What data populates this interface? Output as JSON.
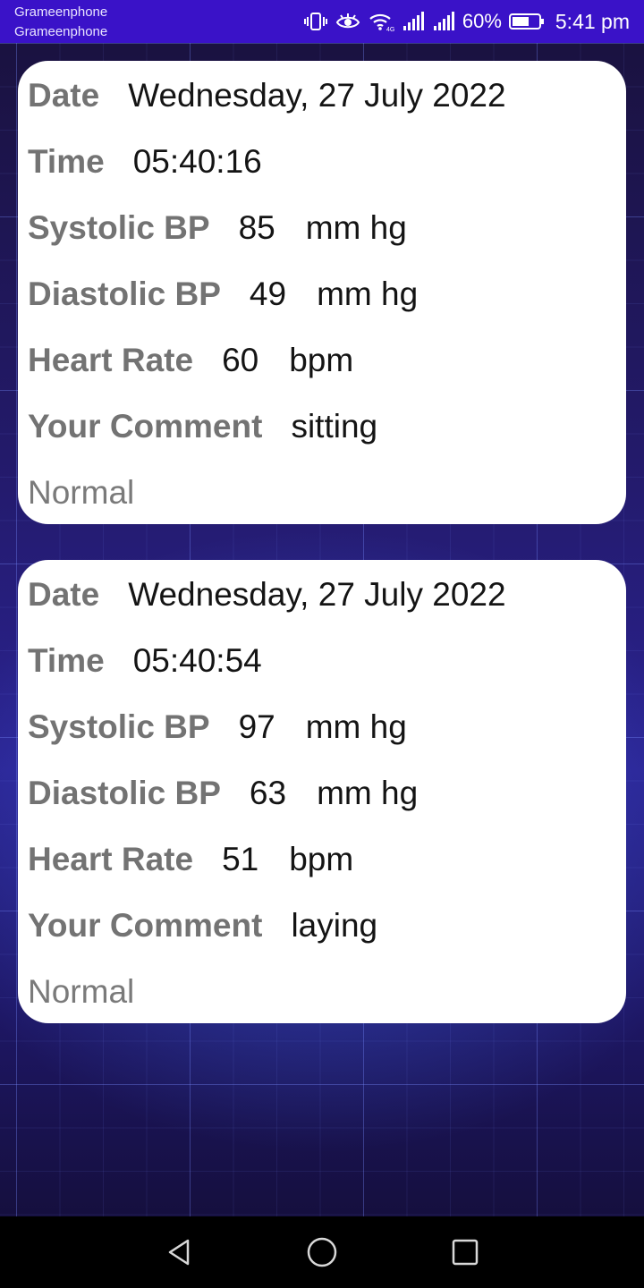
{
  "status_bar": {
    "carrier_1": "Grameenphone",
    "carrier_2": "Grameenphone",
    "battery_percent": "60%",
    "time": "5:41 pm",
    "icons": [
      "vibrate-icon",
      "eye-icon",
      "wifi-icon",
      "signal-icon",
      "signal-icon",
      "battery-icon"
    ]
  },
  "labels": {
    "date": "Date",
    "time": "Time",
    "systolic": "Systolic BP",
    "diastolic": "Diastolic BP",
    "heart_rate": "Heart Rate",
    "comment": "Your Comment"
  },
  "records": [
    {
      "date": "Wednesday, 27 July 2022",
      "time": "05:40:16",
      "systolic": "85",
      "systolic_unit": "mm hg",
      "diastolic": "49",
      "diastolic_unit": "mm hg",
      "heart_rate": "60",
      "heart_rate_unit": "bpm",
      "comment": "sitting",
      "status": "Normal"
    },
    {
      "date": "Wednesday, 27 July 2022",
      "time": "05:40:54",
      "systolic": "97",
      "systolic_unit": "mm hg",
      "diastolic": "63",
      "diastolic_unit": "mm hg",
      "heart_rate": "51",
      "heart_rate_unit": "bpm",
      "comment": "laying",
      "status": "Normal"
    }
  ],
  "nav_bar": {
    "icons": [
      "back-icon",
      "home-icon",
      "recents-icon"
    ]
  },
  "colors": {
    "status_bar": "#3a12c8",
    "card_background": "#ffffff",
    "label_text": "#737373",
    "value_text": "#141414"
  }
}
